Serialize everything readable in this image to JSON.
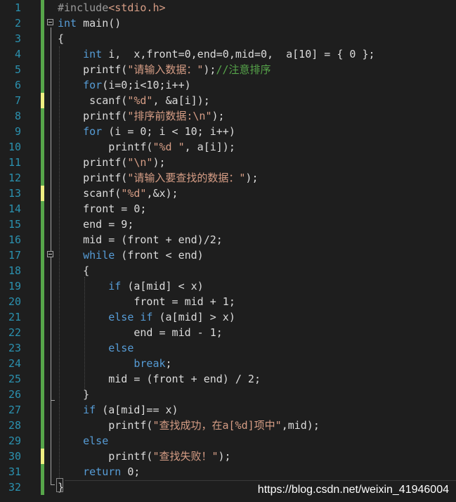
{
  "colors": {
    "background": "#1e1e1e",
    "line_number": "#2b91af",
    "keyword": "#569cd6",
    "string": "#d69d85",
    "comment": "#57a64a",
    "change_saved": "#57a64a",
    "change_unsaved": "#efef81"
  },
  "code_lines": [
    {
      "n": "1",
      "tokens": [
        {
          "t": "#include",
          "c": "pre"
        },
        {
          "t": "<stdio.h>",
          "c": "str"
        }
      ],
      "bar": "green"
    },
    {
      "n": "2",
      "tokens": [
        {
          "t": "int",
          "c": "kw"
        },
        {
          "t": " main()",
          "c": ""
        }
      ],
      "bar": "green",
      "fold": true
    },
    {
      "n": "3",
      "tokens": [
        {
          "t": "{",
          "c": ""
        }
      ],
      "bar": "green"
    },
    {
      "n": "4",
      "tokens": [
        {
          "t": "    "
        },
        {
          "t": "int",
          "c": "kw"
        },
        {
          "t": " i,  x,front=0,end=0,mid=0,  a[10] = { 0 };",
          "c": ""
        }
      ],
      "bar": "green"
    },
    {
      "n": "5",
      "tokens": [
        {
          "t": "    printf("
        },
        {
          "t": "\"请输入数据：\"",
          "c": "str"
        },
        {
          "t": ");"
        },
        {
          "t": "//注意排序",
          "c": "cmt"
        }
      ],
      "bar": "green"
    },
    {
      "n": "6",
      "tokens": [
        {
          "t": "    "
        },
        {
          "t": "for",
          "c": "kw"
        },
        {
          "t": "(i=0;i<10;i++)"
        }
      ],
      "bar": "green"
    },
    {
      "n": "7",
      "tokens": [
        {
          "t": "     scanf("
        },
        {
          "t": "\"%d\"",
          "c": "str"
        },
        {
          "t": ", &a[i]);"
        }
      ],
      "bar": "yellow"
    },
    {
      "n": "8",
      "tokens": [
        {
          "t": "    printf("
        },
        {
          "t": "\"排序前数据:\\n\"",
          "c": "str"
        },
        {
          "t": ");"
        }
      ],
      "bar": "green"
    },
    {
      "n": "9",
      "tokens": [
        {
          "t": "    "
        },
        {
          "t": "for",
          "c": "kw"
        },
        {
          "t": " (i = 0; i < 10; i++)"
        }
      ],
      "bar": "green"
    },
    {
      "n": "10",
      "tokens": [
        {
          "t": "        printf("
        },
        {
          "t": "\"%d \"",
          "c": "str"
        },
        {
          "t": ", a[i]);"
        }
      ],
      "bar": "green"
    },
    {
      "n": "11",
      "tokens": [
        {
          "t": "    printf("
        },
        {
          "t": "\"\\n\"",
          "c": "str"
        },
        {
          "t": ");"
        }
      ],
      "bar": "green"
    },
    {
      "n": "12",
      "tokens": [
        {
          "t": "    printf("
        },
        {
          "t": "\"请输入要查找的数据：\"",
          "c": "str"
        },
        {
          "t": ");"
        }
      ],
      "bar": "green"
    },
    {
      "n": "13",
      "tokens": [
        {
          "t": "    scanf("
        },
        {
          "t": "\"%d\"",
          "c": "str"
        },
        {
          "t": ",&x);"
        }
      ],
      "bar": "yellow"
    },
    {
      "n": "14",
      "tokens": [
        {
          "t": "    front = 0;"
        }
      ],
      "bar": "green"
    },
    {
      "n": "15",
      "tokens": [
        {
          "t": "    end = 9;"
        }
      ],
      "bar": "green"
    },
    {
      "n": "16",
      "tokens": [
        {
          "t": "    mid = (front + end)/2;"
        }
      ],
      "bar": "green"
    },
    {
      "n": "17",
      "tokens": [
        {
          "t": "    "
        },
        {
          "t": "while",
          "c": "kw"
        },
        {
          "t": " (front < end)"
        }
      ],
      "bar": "green",
      "fold": true
    },
    {
      "n": "18",
      "tokens": [
        {
          "t": "    {"
        }
      ],
      "bar": "green"
    },
    {
      "n": "19",
      "tokens": [
        {
          "t": "        "
        },
        {
          "t": "if",
          "c": "kw"
        },
        {
          "t": " (a[mid] < x)"
        }
      ],
      "bar": "green"
    },
    {
      "n": "20",
      "tokens": [
        {
          "t": "            front = mid + 1;"
        }
      ],
      "bar": "green"
    },
    {
      "n": "21",
      "tokens": [
        {
          "t": "        "
        },
        {
          "t": "else if",
          "c": "kw"
        },
        {
          "t": " (a[mid] > x)"
        }
      ],
      "bar": "green"
    },
    {
      "n": "22",
      "tokens": [
        {
          "t": "            end = mid - 1;"
        }
      ],
      "bar": "green"
    },
    {
      "n": "23",
      "tokens": [
        {
          "t": "        "
        },
        {
          "t": "else",
          "c": "kw"
        }
      ],
      "bar": "green"
    },
    {
      "n": "24",
      "tokens": [
        {
          "t": "            "
        },
        {
          "t": "break",
          "c": "kw"
        },
        {
          "t": ";"
        }
      ],
      "bar": "green"
    },
    {
      "n": "25",
      "tokens": [
        {
          "t": "        mid = (front + end) / 2;"
        }
      ],
      "bar": "green"
    },
    {
      "n": "26",
      "tokens": [
        {
          "t": "    }"
        }
      ],
      "bar": "green"
    },
    {
      "n": "27",
      "tokens": [
        {
          "t": "    "
        },
        {
          "t": "if",
          "c": "kw"
        },
        {
          "t": " (a[mid]== x)"
        }
      ],
      "bar": "green"
    },
    {
      "n": "28",
      "tokens": [
        {
          "t": "        printf("
        },
        {
          "t": "\"查找成功，在a[%d]项中\"",
          "c": "str"
        },
        {
          "t": ",mid);"
        }
      ],
      "bar": "green"
    },
    {
      "n": "29",
      "tokens": [
        {
          "t": "    "
        },
        {
          "t": "else",
          "c": "kw"
        }
      ],
      "bar": "green"
    },
    {
      "n": "30",
      "tokens": [
        {
          "t": "        printf("
        },
        {
          "t": "\"查找失败！\"",
          "c": "str"
        },
        {
          "t": ");"
        }
      ],
      "bar": "yellow"
    },
    {
      "n": "31",
      "tokens": [
        {
          "t": "    "
        },
        {
          "t": "return",
          "c": "kw"
        },
        {
          "t": " 0;"
        }
      ],
      "bar": "green"
    },
    {
      "n": "32",
      "tokens": [
        {
          "t": "}"
        }
      ],
      "bar": "green"
    }
  ],
  "watermark": "https://blog.csdn.net/weixin_41946004"
}
